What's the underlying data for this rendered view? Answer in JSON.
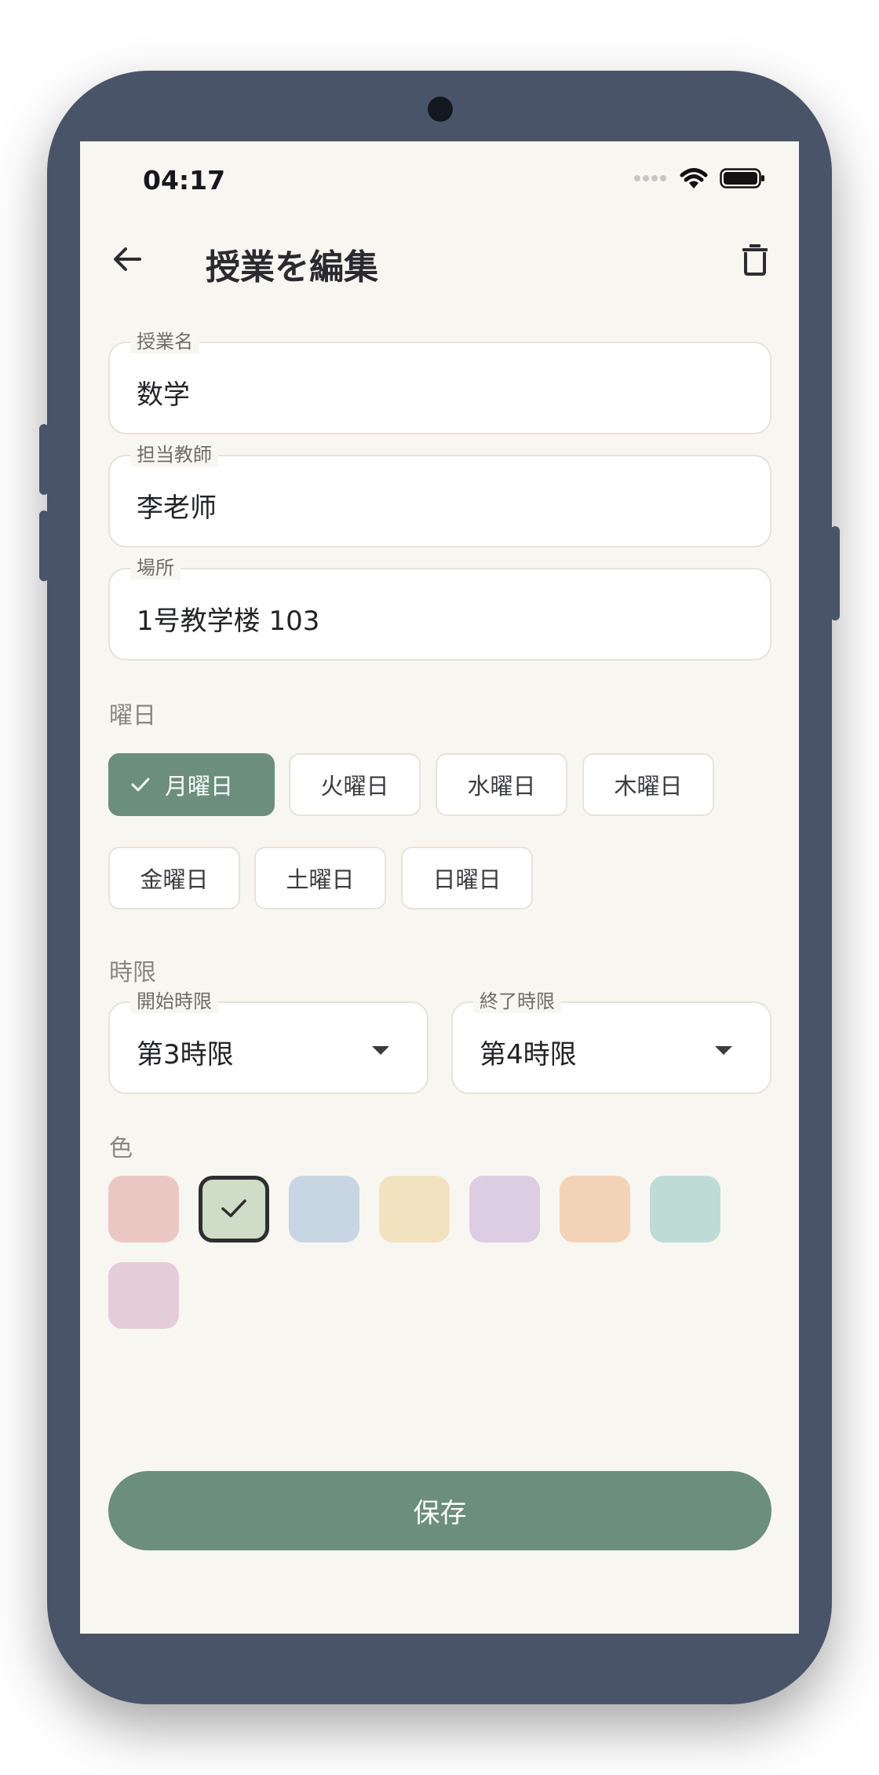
{
  "status_bar": {
    "time": "04:17"
  },
  "header": {
    "title": "授業を編集"
  },
  "fields": {
    "course_name": {
      "label": "授業名",
      "value": "数学"
    },
    "teacher": {
      "label": "担当教師",
      "value": "李老师"
    },
    "location": {
      "label": "場所",
      "value": "1号教学楼 103"
    }
  },
  "weekday": {
    "label": "曜日",
    "days": [
      "月曜日",
      "火曜日",
      "水曜日",
      "木曜日",
      "金曜日",
      "土曜日",
      "日曜日"
    ],
    "selected": "月曜日"
  },
  "period": {
    "label": "時限",
    "start": {
      "label": "開始時限",
      "value": "第3時限"
    },
    "end": {
      "label": "終了時限",
      "value": "第4時限"
    }
  },
  "color": {
    "label": "色",
    "swatches": [
      "#ebc7c4",
      "#cfdcc7",
      "#c8d6e4",
      "#f2e3c0",
      "#dccde2",
      "#f2d3b8",
      "#bfdbd6",
      "#e4ccd8"
    ],
    "selected_index": 1
  },
  "save_button": {
    "label": "保存"
  },
  "colors": {
    "accent": "#6c8e7c",
    "background": "#f8f6f1",
    "device": "#4a5468"
  }
}
